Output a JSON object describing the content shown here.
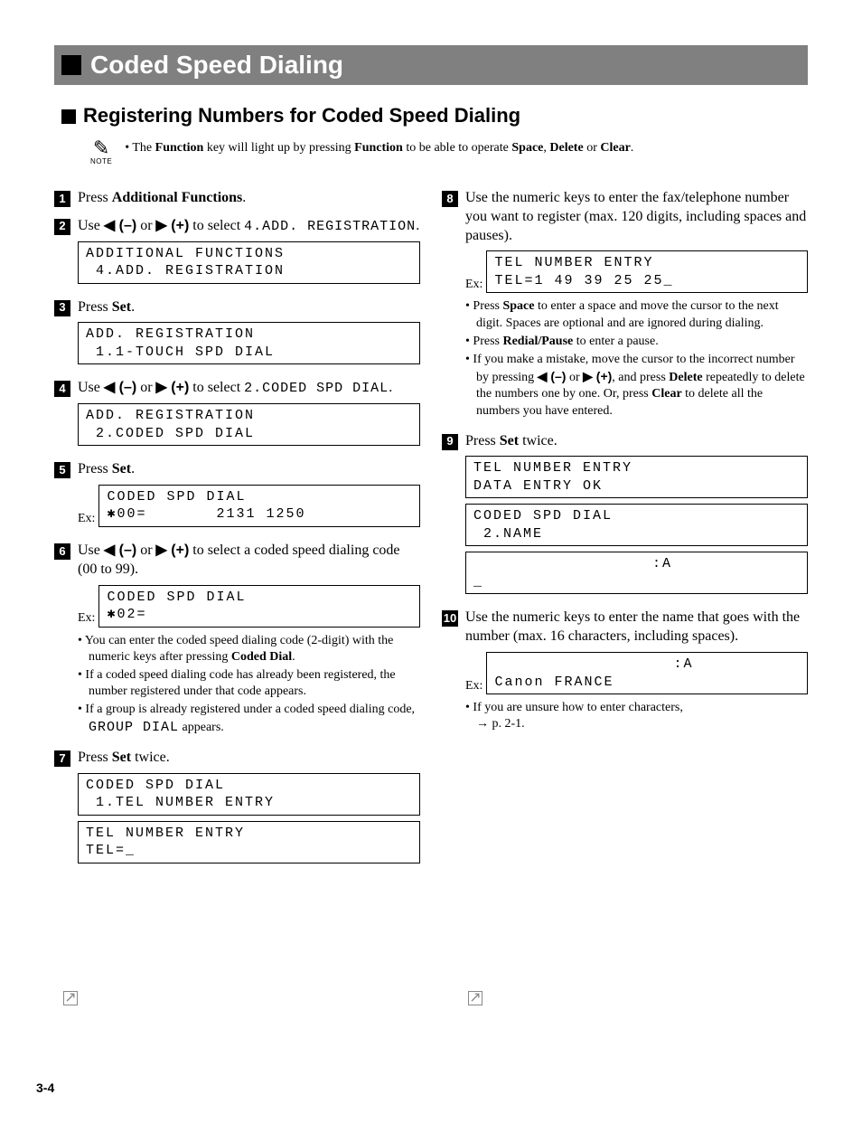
{
  "title": "Coded Speed Dialing",
  "subtitle": "Registering Numbers for Coded Speed Dialing",
  "note": {
    "label": "NOTE",
    "text_pre": "• The ",
    "kw1": "Function",
    "text_mid1": " key will light up by pressing ",
    "kw2": "Function",
    "text_mid2": " to be able to operate ",
    "kw3": "Space",
    "comma1": ", ",
    "kw4": "Delete",
    "text_or": " or ",
    "kw5": "Clear",
    "text_end": "."
  },
  "left": {
    "s1": {
      "pre": "Press ",
      "b": "Additional Functions",
      "post": "."
    },
    "s2": {
      "pre": "Use ",
      "m1": "◀ (–)",
      "or": " or ",
      "p1": "▶ (+)",
      "mid": " to select ",
      "mono": "4.ADD. REGISTRATION",
      "post": "."
    },
    "lcd2": "ADDITIONAL FUNCTIONS\n 4.ADD. REGISTRATION",
    "s3": {
      "pre": "Press ",
      "b": "Set",
      "post": "."
    },
    "lcd3": "ADD. REGISTRATION\n 1.1-TOUCH SPD DIAL",
    "s4": {
      "pre": "Use ",
      "m1": "◀ (–)",
      "or": " or ",
      "p1": "▶ (+)",
      "mid": " to select ",
      "mono": "2.CODED SPD DIAL",
      "post": "."
    },
    "lcd4": "ADD. REGISTRATION\n 2.CODED SPD DIAL",
    "s5": {
      "pre": "Press ",
      "b": "Set",
      "post": "."
    },
    "lcd5": "CODED SPD DIAL\n✱00=       2131 1250",
    "s6": {
      "pre": "Use ",
      "m1": "◀ (–)",
      "or": " or ",
      "p1": "▶ (+)",
      "post": " to select a coded speed dialing code (00 to 99)."
    },
    "lcd6": "CODED SPD DIAL\n✱02=",
    "b6a_pre": "You can enter the coded speed dialing code (2-digit) with the numeric keys after pressing ",
    "b6a_b": "Coded Dial",
    "b6a_post": ".",
    "b6b": "If a coded speed dialing code has already been registered, the number registered under that code appears.",
    "b6c_pre": "If a group is already registered under a coded speed dialing code, ",
    "b6c_mono": "GROUP DIAL",
    "b6c_post": " appears.",
    "s7": {
      "pre": "Press ",
      "b": "Set",
      "post": " twice."
    },
    "lcd7a": "CODED SPD DIAL\n 1.TEL NUMBER ENTRY",
    "lcd7b": "TEL NUMBER ENTRY\nTEL=_"
  },
  "right": {
    "s8": "Use the numeric keys to enter the fax/telephone number you want to register (max. 120 digits, including spaces and pauses).",
    "lcd8": "TEL NUMBER ENTRY\nTEL=1 49 39 25 25_",
    "b8a_pre": "Press ",
    "b8a_b": "Space",
    "b8a_post": " to enter a space and move the cursor to the next digit. Spaces are optional and are ignored during dialing.",
    "b8b_pre": "Press ",
    "b8b_b": "Redial/Pause",
    "b8b_post": " to enter a pause.",
    "b8c_pre": "If you make a mistake, move the cursor to the incorrect number by pressing ",
    "b8c_m1": "◀ (–)",
    "b8c_or": " or ",
    "b8c_p1": "▶ (+)",
    "b8c_mid": ", and press ",
    "b8c_b1": "Delete",
    "b8c_mid2": " repeatedly to delete the numbers one by one. Or, press ",
    "b8c_b2": "Clear",
    "b8c_post": " to delete all the numbers you have entered.",
    "s9": {
      "pre": "Press ",
      "b": "Set",
      "post": " twice."
    },
    "lcd9a": "TEL NUMBER ENTRY\nDATA ENTRY OK",
    "lcd9b": "CODED SPD DIAL\n 2.NAME",
    "lcd9c": "                  :A\n_",
    "s10": "Use the numeric keys to enter the name that goes with the number (max. 16 characters, including spaces).",
    "lcd10": "                  :A\nCanon FRANCE",
    "b10_pre": "If you are unsure how to enter characters, ",
    "b10_arrow": "→",
    "b10_post": " p. 2-1."
  },
  "page": "3-4",
  "ex": "Ex:"
}
